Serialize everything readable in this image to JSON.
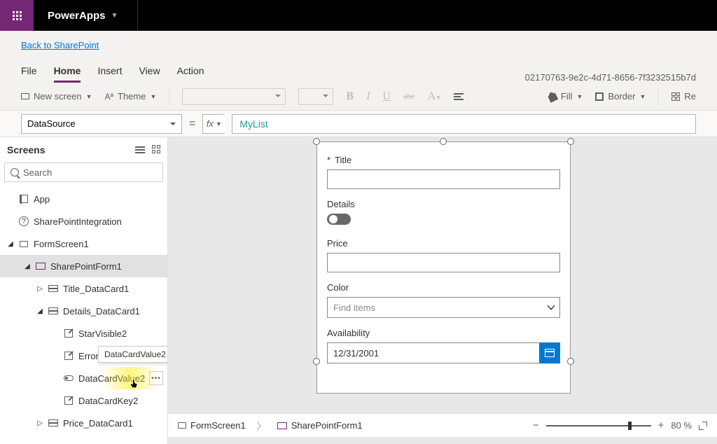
{
  "app_title": "PowerApps",
  "back_link": "Back to SharePoint",
  "menu": [
    "File",
    "Home",
    "Insert",
    "View",
    "Action"
  ],
  "menu_active": "Home",
  "file_id": "02170763-9e2c-4d71-8656-7f3232515b7d",
  "ribbon": {
    "new_screen": "New screen",
    "theme": "Theme",
    "fill": "Fill",
    "border": "Border",
    "reorder": "Re"
  },
  "property": "DataSource",
  "formula_value": "MyList",
  "left_pane": {
    "header": "Screens",
    "search_placeholder": "Search",
    "tree": {
      "app": "App",
      "sp_integration": "SharePointIntegration",
      "form_screen": "FormScreen1",
      "form": "SharePointForm1",
      "title_card": "Title_DataCard1",
      "details_card": "Details_DataCard1",
      "star": "StarVisible2",
      "error": "ErrorM",
      "value": "DataCardValue2",
      "key": "DataCardKey2",
      "price_card": "Price_DataCard1"
    },
    "tooltip": "DataCardValue2"
  },
  "form": {
    "title_label": "Title",
    "details_label": "Details",
    "price_label": "Price",
    "color_label": "Color",
    "color_placeholder": "Find items",
    "availability_label": "Availability",
    "date_value": "12/31/2001",
    "details_toggle": false
  },
  "breadcrumb": {
    "screen": "FormScreen1",
    "form": "SharePointForm1"
  },
  "zoom": "80 %"
}
